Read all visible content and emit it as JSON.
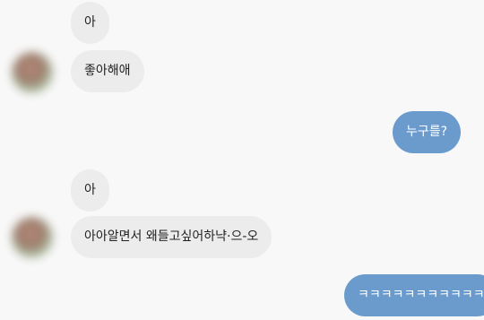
{
  "colors": {
    "background": "#f8f8f8",
    "incoming_bubble": "#ececec",
    "incoming_text": "#222222",
    "outgoing_bubble": "#6b9bcc",
    "outgoing_text": "#ffffff"
  },
  "messages": [
    {
      "direction": "incoming",
      "text": "아"
    },
    {
      "direction": "incoming",
      "text": "좋아해애"
    },
    {
      "direction": "outgoing",
      "text": "누구를?"
    },
    {
      "direction": "incoming",
      "text": "아"
    },
    {
      "direction": "incoming",
      "text": "아아알면서 왜들고싶어하냑·으-오"
    },
    {
      "direction": "outgoing",
      "text": "ㅋㅋㅋㅋㅋㅋㅋㅋㅋㅋㅋ"
    }
  ]
}
